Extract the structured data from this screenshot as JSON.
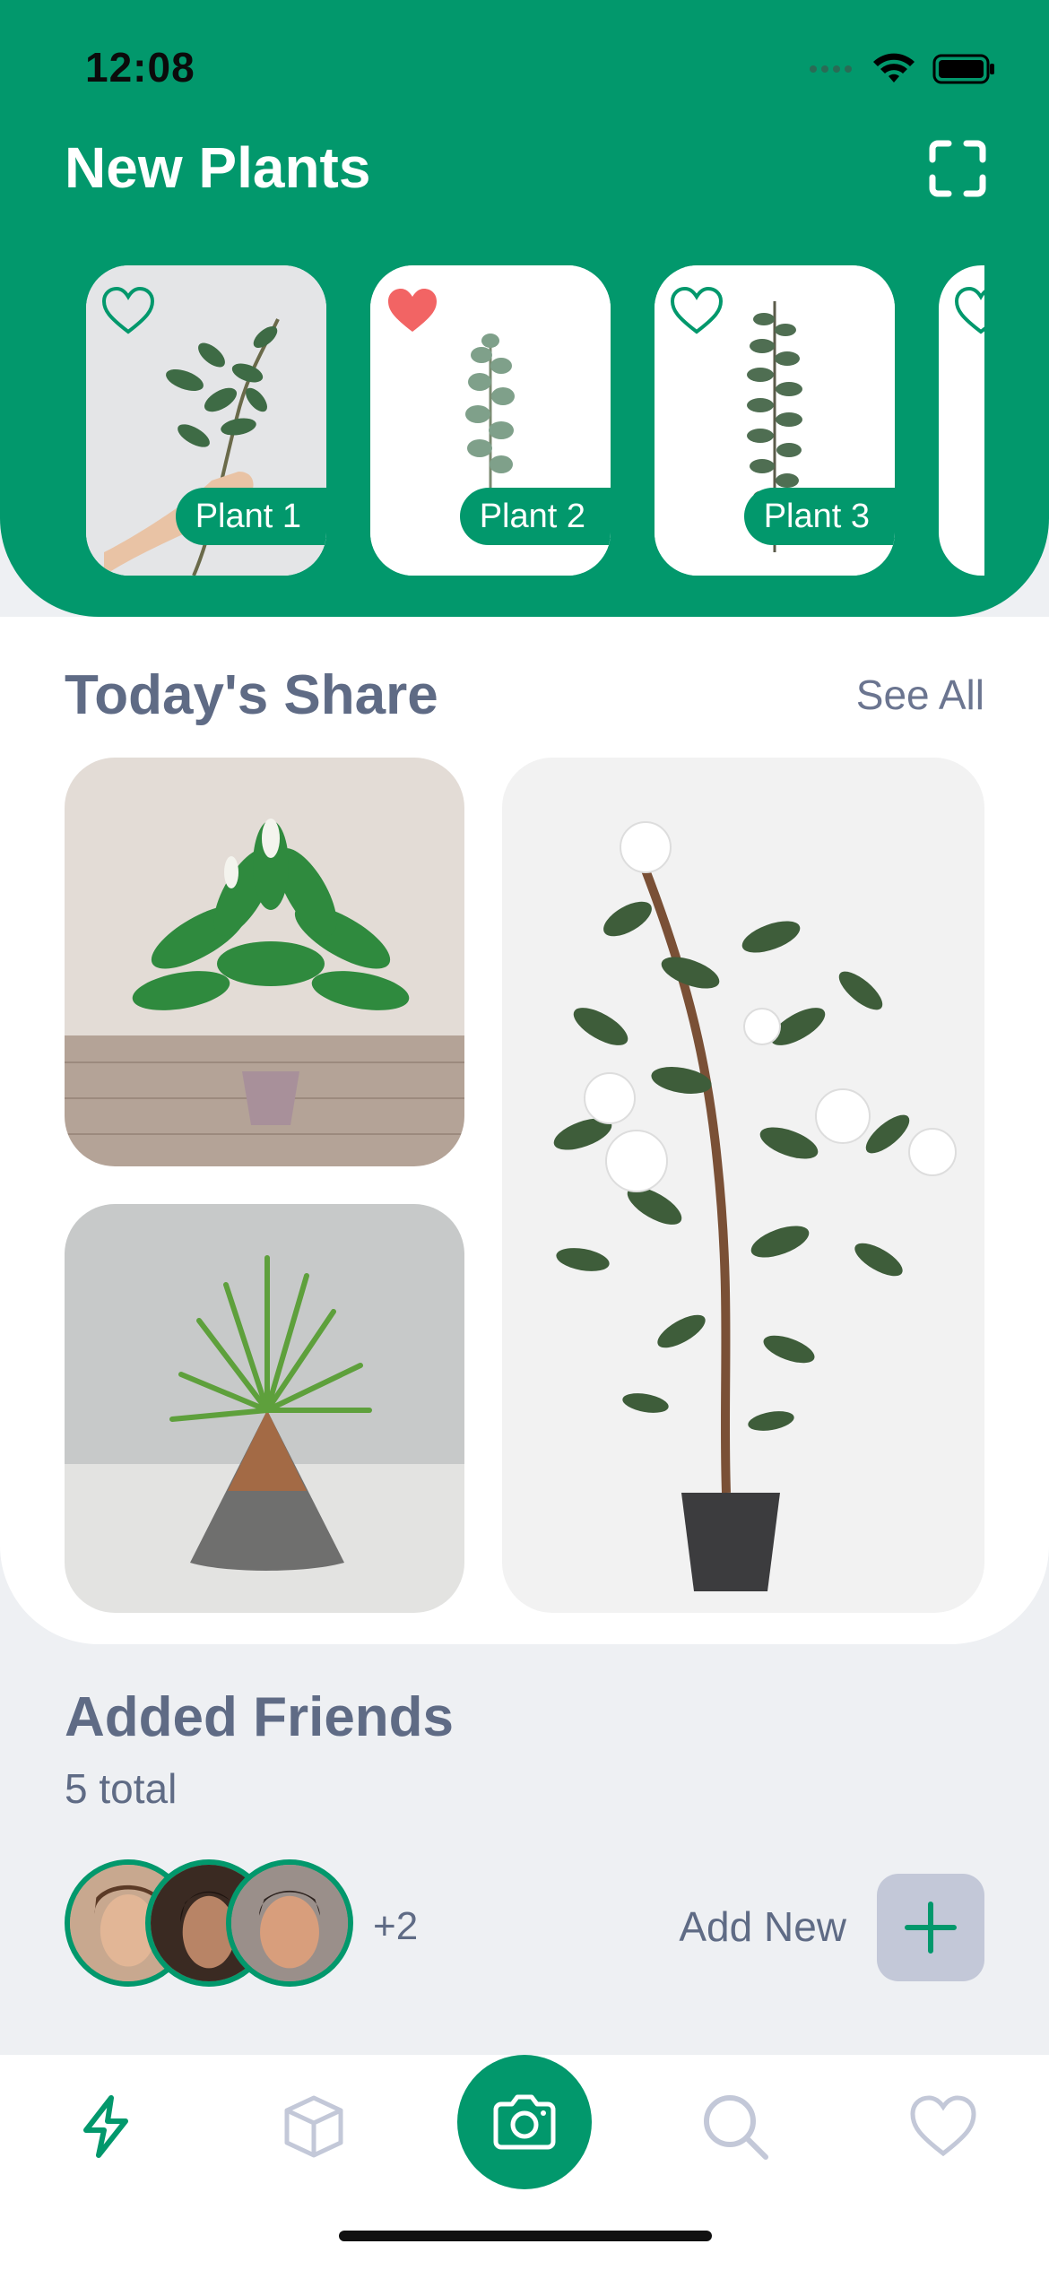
{
  "status_bar": {
    "time": "12:08"
  },
  "header": {
    "title": "New Plants"
  },
  "new_plants": [
    {
      "label": "Plant 1",
      "favorited": false
    },
    {
      "label": "Plant 2",
      "favorited": true
    },
    {
      "label": "Plant 3",
      "favorited": false
    }
  ],
  "share": {
    "title": "Today's Share",
    "see_all": "See All"
  },
  "friends": {
    "title": "Added Friends",
    "total": "5 total",
    "more_count": "+2",
    "add_new": "Add New"
  },
  "tabbar": {
    "items": [
      "activity-icon",
      "box-icon",
      "camera-icon",
      "search-icon",
      "heart-icon"
    ],
    "accent": "#02986C",
    "inactive": "#C3C8D8"
  },
  "colors": {
    "brand": "#02986C",
    "favorite": "#F26464",
    "text_muted": "#5F6B85",
    "background": "#EEF0F3"
  }
}
